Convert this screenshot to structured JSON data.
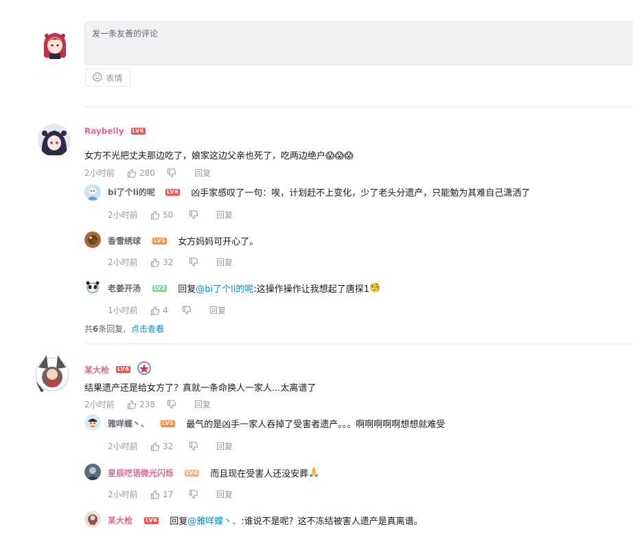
{
  "input": {
    "placeholder": "发一条友善的评论",
    "emoji_label": "表情"
  },
  "comments": [
    {
      "user": "Raybelly",
      "name_color": "#e06a8b",
      "level": "LV6",
      "level_color": "#ff4d4f",
      "text": "女方不光把丈夫那边吃了，娘家这边父亲也死了，吃两边绝户",
      "emojis": "😱😱😱",
      "time": "2小时前",
      "likes": "280",
      "reply_label": "回复",
      "replies": [
        {
          "user": "bi了个li的呢",
          "level": "LV6",
          "level_color": "#ff4d4f",
          "text": "凶手家感叹了一句：唉，计划赶不上变化，少了老头分遗产，只能勉为其难自己潇洒了",
          "time": "2小时前",
          "likes": "50",
          "reply_label": "回复"
        },
        {
          "user": "香雪绣球",
          "level": "LV5",
          "level_color": "#ff8a3d",
          "text": "女方妈妈可开心了。",
          "time": "2小时前",
          "likes": "32",
          "reply_label": "回复"
        },
        {
          "user": "老姜开汤",
          "level": "LV2",
          "level_color": "#8bd29b",
          "reply_prefix": "回复 ",
          "mention": "@bi了个li的呢",
          "text": " :这操作操作让我想起了唐探1",
          "emoji": "🧐",
          "time": "1小时前",
          "likes": "4",
          "reply_label": "回复"
        }
      ],
      "summary_prefix": "共",
      "summary_count": "6",
      "summary_suffix": "条回复,",
      "summary_link": "点击查看"
    },
    {
      "user": "某大枪",
      "name_color": "#e06a8b",
      "level": "LV6",
      "level_color": "#ff4d4f",
      "text": "结果遗产还是给女方了？真就一条命换人一家人...太离谱了",
      "time": "2小时前",
      "likes": "238",
      "reply_label": "回复",
      "replies": [
        {
          "user": "雅咩蝶丶、",
          "level": "LV5",
          "level_color": "#ff8a3d",
          "text": "最气的是凶手一家人吞掉了受害者遗产。。。啊啊啊啊啊想想就难受",
          "time": "2小时前",
          "likes": "32",
          "reply_label": "回复"
        },
        {
          "user": "星辰呓语微光闪烁",
          "name_color": "#e06a8b",
          "level": "LV4",
          "level_color": "#ffb37a",
          "text": "而且现在受害人还没安葬",
          "emoji": "🙏",
          "time": "2小时前",
          "likes": "17",
          "reply_label": "回复"
        },
        {
          "user": "某大枪",
          "name_color": "#e06a8b",
          "level": "LV6",
          "level_color": "#ff4d4f",
          "reply_prefix": "回复 ",
          "mention": "@雅咩蝶丶、",
          "text": " :谁说不是呢？这不冻结被害人遗产是真离谱。"
        }
      ]
    }
  ]
}
